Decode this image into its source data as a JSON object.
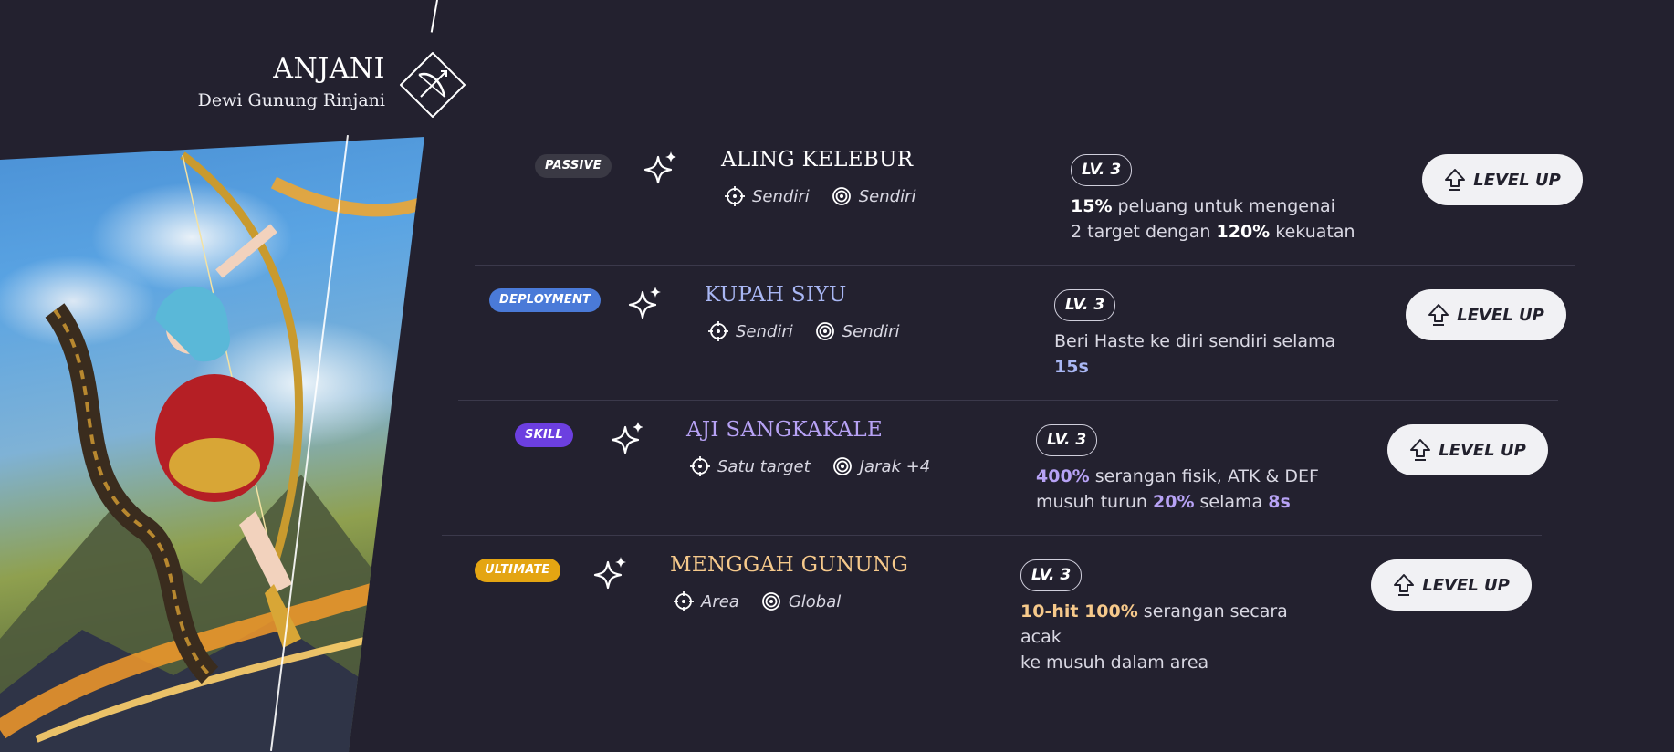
{
  "hero": {
    "name": "ANJANI",
    "title": "Dewi Gunung Rinjani",
    "class_icon": "archer-bow-icon"
  },
  "colors": {
    "background": "#23212f",
    "passive": "#3a3944",
    "deployment": "#4a7ad8",
    "skill": "#6c3fe0",
    "ultimate": "#e4a512",
    "highlight_deployment": "#a9b7f4",
    "highlight_skill": "#b7a2f5",
    "highlight_ultimate": "#f6c98b"
  },
  "skills": [
    {
      "tag": "PASSIVE",
      "name": "ALING KELEBUR",
      "target": "Sendiri",
      "range": "Sendiri",
      "level": "LV. 3",
      "desc_line1": {
        "b1": "15%",
        "t1": " peluang untuk mengenai"
      },
      "desc_line2": {
        "t1": "2 target dengan ",
        "b1": "120%",
        "t2": " kekuatan"
      },
      "button": "LEVEL UP"
    },
    {
      "tag": "DEPLOYMENT",
      "name": "KUPAH SIYU",
      "target": "Sendiri",
      "range": "Sendiri",
      "level": "LV. 3",
      "desc_line1": {
        "t1": "Beri Haste ke diri sendiri selama"
      },
      "desc_line2": {
        "b1": "15s"
      },
      "button": "LEVEL UP"
    },
    {
      "tag": "SKILL",
      "name": "AJI SANGKAKALE",
      "target": "Satu target",
      "range": "Jarak +4",
      "level": "LV. 3",
      "desc_line1": {
        "b1": "400%",
        "t1": " serangan fisik, ATK & DEF"
      },
      "desc_line2": {
        "t1": "musuh turun ",
        "b1": "20%",
        "t2": " selama ",
        "b2": "8s"
      },
      "button": "LEVEL UP"
    },
    {
      "tag": "ULTIMATE",
      "name": "MENGGAH GUNUNG",
      "target": "Area",
      "range": "Global",
      "level": "LV. 3",
      "desc_line1": {
        "b1": "10-hit 100%",
        "t1": " serangan secara acak"
      },
      "desc_line2": {
        "t1": "ke musuh dalam area"
      },
      "button": "LEVEL UP"
    }
  ]
}
